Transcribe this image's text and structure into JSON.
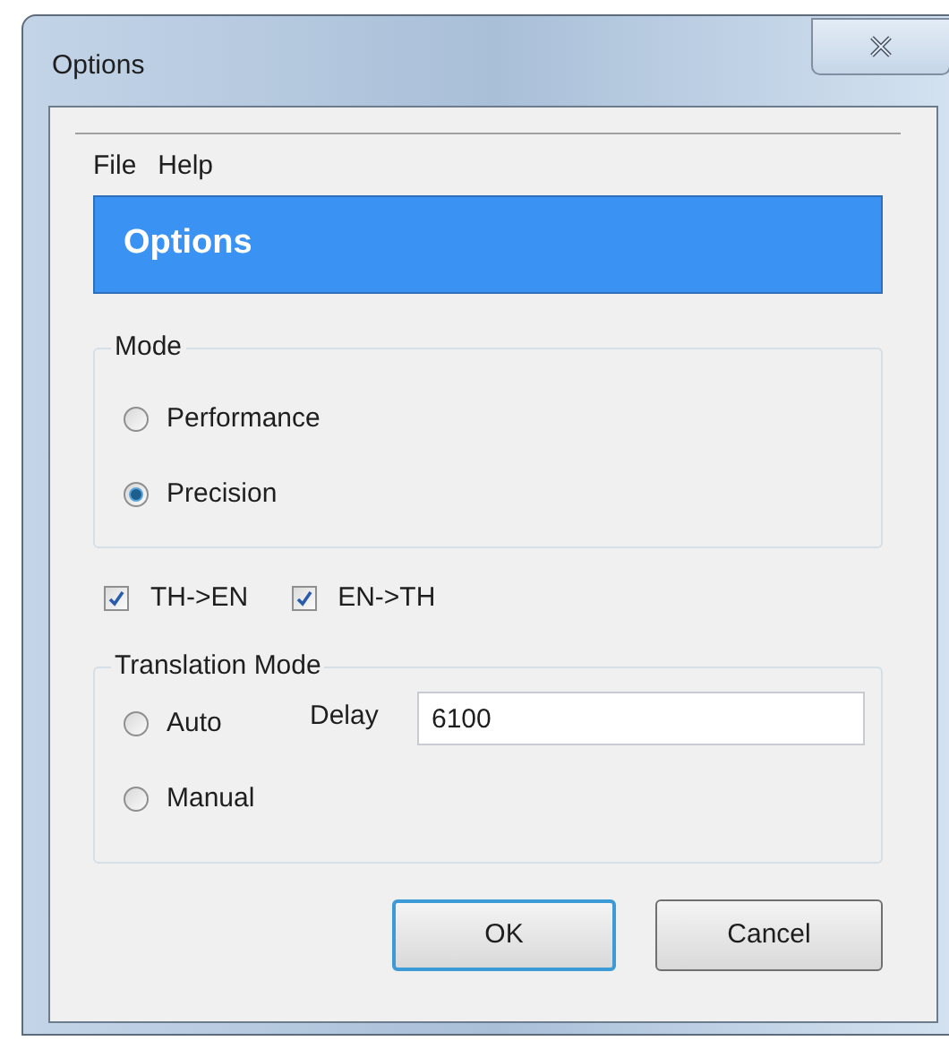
{
  "window": {
    "title": "Options"
  },
  "menu": [
    {
      "label": "File"
    },
    {
      "label": "Help"
    }
  ],
  "banner": {
    "title": "Options"
  },
  "mode_group": {
    "label": "Mode",
    "options": [
      {
        "label": "Performance",
        "selected": false
      },
      {
        "label": "Precision",
        "selected": true
      }
    ]
  },
  "directions": [
    {
      "label": "TH->EN",
      "checked": true
    },
    {
      "label": "EN->TH",
      "checked": true
    }
  ],
  "translation_group": {
    "label": "Translation Mode",
    "options": [
      {
        "label": "Auto",
        "selected": false
      },
      {
        "label": "Manual",
        "selected": false
      }
    ],
    "delay": {
      "label": "Delay",
      "value": "6100"
    }
  },
  "buttons": [
    {
      "label": "OK",
      "default": true
    },
    {
      "label": "Cancel",
      "default": false
    }
  ]
}
